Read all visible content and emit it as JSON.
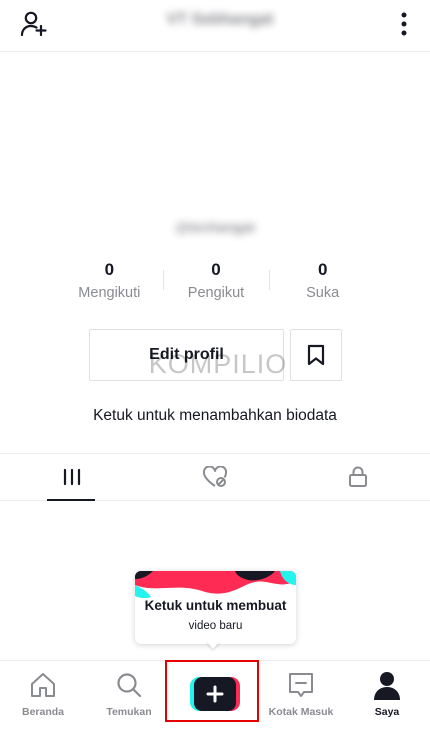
{
  "header": {
    "title": "VT Sebhangat",
    "add_user_icon": "add-user-icon",
    "more_icon": "more-vertical-icon"
  },
  "profile": {
    "username": "@techangat",
    "stats": [
      {
        "value": "0",
        "label": "Mengikuti"
      },
      {
        "value": "0",
        "label": "Pengikut"
      },
      {
        "value": "0",
        "label": "Suka"
      }
    ],
    "edit_label": "Edit profil",
    "watermark": "KOMPILIO",
    "bio_prompt": "Ketuk untuk menambahkan biodata"
  },
  "tabs": {
    "items": [
      {
        "icon": "videos-grid-icon"
      },
      {
        "icon": "liked-hidden-icon"
      },
      {
        "icon": "lock-icon"
      }
    ]
  },
  "tooltip": {
    "title": "Ketuk untuk membuat",
    "subtitle": "video baru"
  },
  "nav": {
    "items": [
      {
        "label": "Beranda",
        "icon": "home-icon"
      },
      {
        "label": "Temukan",
        "icon": "search-icon"
      },
      {
        "label": "",
        "icon": "create-plus-icon"
      },
      {
        "label": "Kotak Masuk",
        "icon": "inbox-icon"
      },
      {
        "label": "Saya",
        "icon": "profile-icon"
      }
    ]
  },
  "colors": {
    "text": "#161823",
    "muted": "#8a8b91",
    "cyan": "#25f4ee",
    "red": "#fe2c55",
    "highlight": "#e60000"
  }
}
